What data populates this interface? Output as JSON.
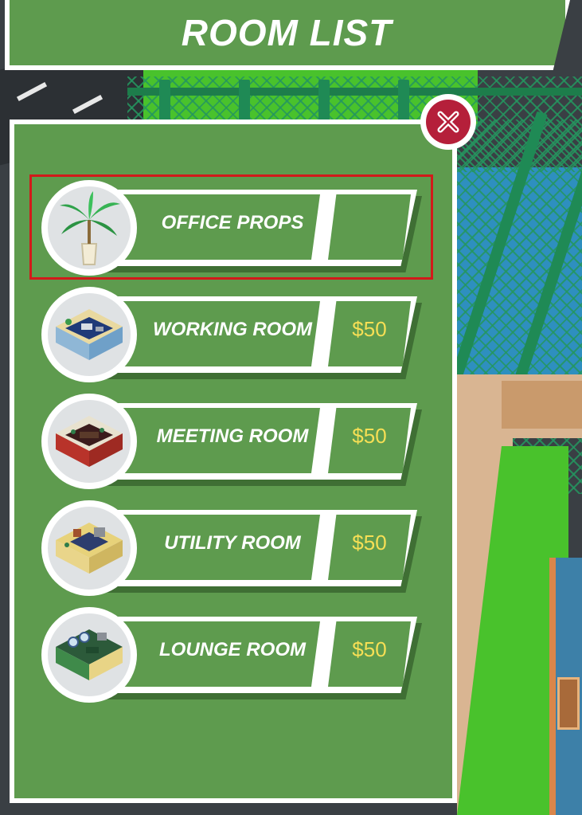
{
  "header": {
    "title": "ROOM LIST"
  },
  "panel": {
    "close_icon": "close-x-icon"
  },
  "rooms": [
    {
      "label": "OFFICE PROPS",
      "price": "",
      "thumb_icon": "palm-plant-icon",
      "selected": true
    },
    {
      "label": "WORKING ROOM",
      "price": "$50",
      "thumb_icon": "working-room-icon",
      "selected": false
    },
    {
      "label": "MEETING ROOM",
      "price": "$50",
      "thumb_icon": "meeting-room-icon",
      "selected": false
    },
    {
      "label": "UTILITY ROOM",
      "price": "$50",
      "thumb_icon": "utility-room-icon",
      "selected": false
    },
    {
      "label": "LOUNGE ROOM",
      "price": "$50",
      "thumb_icon": "lounge-room-icon",
      "selected": false
    }
  ],
  "colors": {
    "panel_green": "#5e9b4e",
    "price_yellow": "#f6df55",
    "close_red": "#b51f3a",
    "selection_red": "#d21a1a"
  }
}
